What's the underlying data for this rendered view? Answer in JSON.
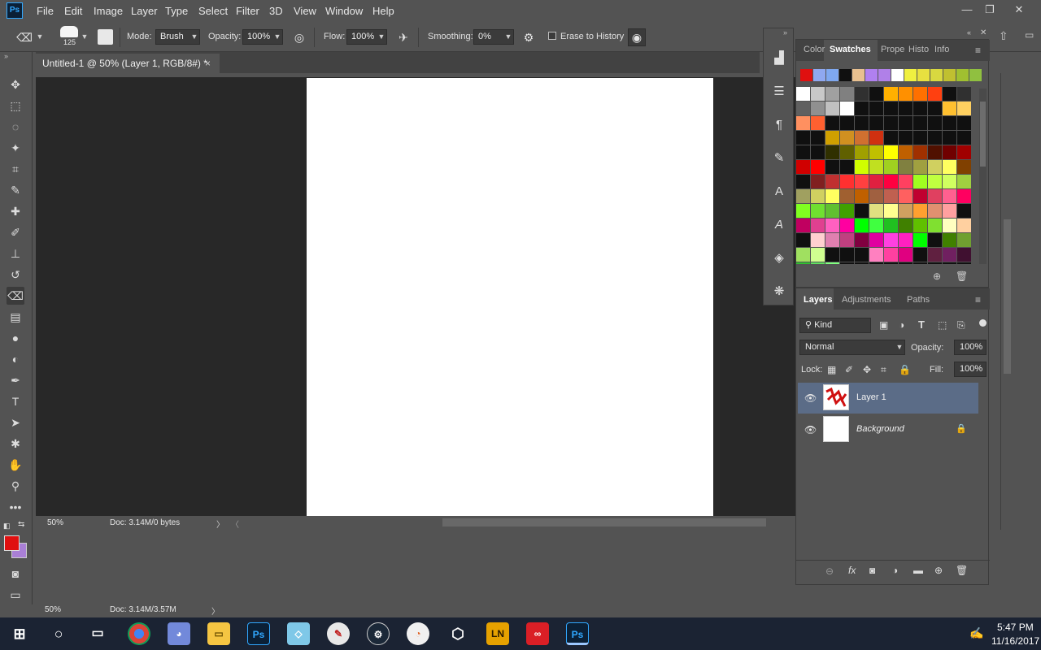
{
  "app": {
    "logo": "Ps"
  },
  "menu": [
    "File",
    "Edit",
    "Image",
    "Layer",
    "Type",
    "Select",
    "Filter",
    "3D",
    "View",
    "Window",
    "Help"
  ],
  "window_controls": {
    "minimize": "—",
    "restore": "❐",
    "close": "✕"
  },
  "options": {
    "brush_size": "125",
    "mode_label": "Mode:",
    "mode_value": "Brush",
    "opacity_label": "Opacity:",
    "opacity_value": "100%",
    "flow_label": "Flow:",
    "flow_value": "100%",
    "smoothing_label": "Smoothing:",
    "smoothing_value": "0%",
    "erase_history_label": "Erase to History",
    "erase_history_checked": false
  },
  "document_tab": {
    "title": "Untitled-1 @ 50% (Layer 1, RGB/8#) *",
    "close": "×"
  },
  "status": {
    "zoom": "50%",
    "doc": "Doc: 3.14M/0 bytes"
  },
  "lower_status": {
    "zoom": "50%",
    "doc": "Doc: 3.14M/3.57M"
  },
  "colors": {
    "foreground": "#e01010",
    "background": "#a97fd6"
  },
  "panels": {
    "top_tabs": [
      "Color",
      "Swatches",
      "Prope",
      "Histo",
      "Info"
    ],
    "active_top_tab": "Swatches",
    "layer_tabs": [
      "Layers",
      "Adjustments",
      "Paths"
    ],
    "active_layer_tab": "Layers"
  },
  "swatches": {
    "recent": [
      "#e01010",
      "#8fa8f0",
      "#7fa8f0",
      "#101010",
      "#e8c090",
      "#b080f0",
      "#b080e8",
      "#ffffff",
      "#f0f040",
      "#e8e040",
      "#d8d840",
      "#c0c030",
      "#a0c030",
      "#90c040"
    ],
    "grid": [
      [
        "#ffffff",
        "#c8c8c8",
        "#a0a0a0",
        "#808080",
        "#303030",
        "#101010",
        "#ffb000",
        "#ff9000",
        "#ff7000",
        "#ff4010",
        "#101010",
        "#303030"
      ],
      [
        "#606060",
        "#909090",
        "#c0c0c0",
        "#ffffff",
        "#101010",
        "#101010",
        "#101010",
        "#101010",
        "#101010",
        "#101010",
        "#ffc030",
        "#ffd060"
      ],
      [
        "#ff9060",
        "#ff6030",
        "#101010",
        "#101010",
        "#101010",
        "#101010",
        "#101010",
        "#101010",
        "#101010",
        "#101010",
        "#101010",
        "#101010"
      ],
      [
        "#101010",
        "#101010",
        "#d0a000",
        "#d09020",
        "#d07030",
        "#d03010",
        "#101010",
        "#101010",
        "#101010",
        "#101010",
        "#101010",
        "#101010"
      ],
      [
        "#101010",
        "#101010",
        "#303000",
        "#606000",
        "#a0a000",
        "#c0c000",
        "#ffff00",
        "#c06000",
        "#a03000",
        "#501000",
        "#700000",
        "#a00000"
      ],
      [
        "#d00000",
        "#ff0000",
        "#101010",
        "#101010",
        "#d0ff00",
        "#c0e020",
        "#a0d020",
        "#808040",
        "#a0a040",
        "#d0d060",
        "#ffff60",
        "#804000"
      ],
      [
        "#101010",
        "#802020",
        "#c03030",
        "#ff3030",
        "#ff4040",
        "#e02040",
        "#ff0040",
        "#ff4060",
        "#a0ff20",
        "#c0ff40",
        "#d0ff60",
        "#a0d040"
      ],
      [
        "#a0a060",
        "#d0d060",
        "#ffff60",
        "#a06030",
        "#c06000",
        "#a06040",
        "#c06050",
        "#ff6060",
        "#c00030",
        "#e04060",
        "#ff6090",
        "#ff0060"
      ],
      [
        "#80ff20",
        "#70e030",
        "#60c030",
        "#40a000",
        "#101010",
        "#e0e080",
        "#ffff90",
        "#d0a060",
        "#ffa030",
        "#e09070",
        "#ffa0a0",
        "#101010"
      ],
      [
        "#c00060",
        "#e04090",
        "#ff60c0",
        "#ff00a0",
        "#00ff00",
        "#40ff40",
        "#20c020",
        "#408000",
        "#60c000",
        "#80e030",
        "#ffffc0",
        "#ffd0a0"
      ],
      [
        "#101010",
        "#ffd0d0",
        "#e080b0",
        "#c04080",
        "#800040",
        "#e000a0",
        "#ff40e0",
        "#ff20c0",
        "#00ff00",
        "#101010",
        "#408000",
        "#70a030"
      ],
      [
        "#a0e060",
        "#d0ff90",
        "#101010",
        "#101010",
        "#101010",
        "#ff80c0",
        "#ff40a0",
        "#e00080",
        "#101010",
        "#602040",
        "#702060",
        "#401030"
      ],
      [
        "#30c030",
        "#60e060",
        "#80ff80",
        "#101010",
        "#101010",
        "#101010",
        "#101010",
        "#101010",
        "#101010",
        "#101010",
        "#101010",
        "#101010"
      ]
    ]
  },
  "layers": {
    "kind_label": "Kind",
    "blend_mode": "Normal",
    "opacity_label": "Opacity:",
    "opacity_value": "100%",
    "lock_label": "Lock:",
    "fill_label": "Fill:",
    "fill_value": "100%",
    "items": [
      {
        "name": "Layer 1",
        "selected": true,
        "locked": false
      },
      {
        "name": "Background",
        "selected": false,
        "locked": true
      }
    ]
  },
  "taskbar": {
    "time": "5:47 PM",
    "date": "11/16/2017",
    "apps": [
      "Windows",
      "Search",
      "Task View",
      "Chrome",
      "Discord",
      "File Explorer",
      "Photoshop",
      "Notes",
      "Krita",
      "Steam",
      "Paint",
      "Unity",
      "LN",
      "Creative Cloud",
      "Photoshop"
    ]
  }
}
